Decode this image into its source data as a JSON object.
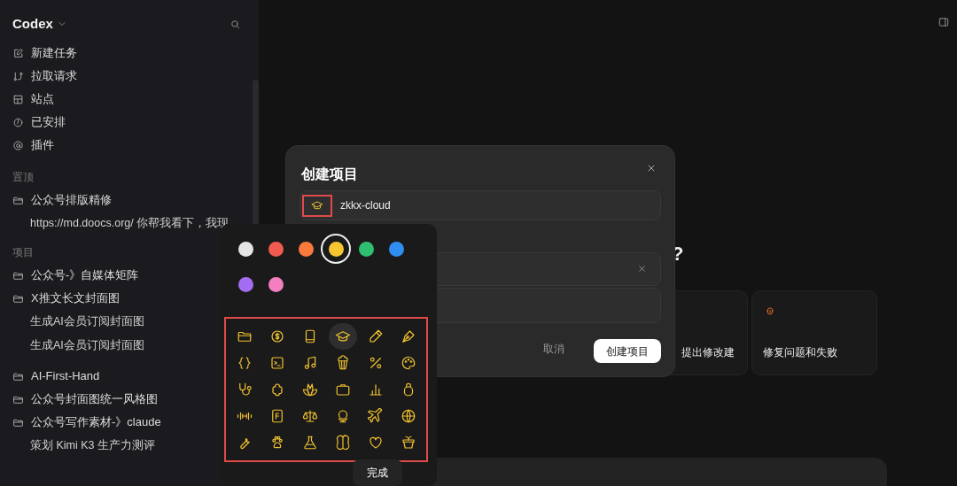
{
  "sidebar": {
    "title": "Codex",
    "nav": [
      {
        "label": "新建任务",
        "kind": "edit"
      },
      {
        "label": "拉取请求",
        "kind": "pull"
      },
      {
        "label": "站点",
        "kind": "site"
      },
      {
        "label": "已安排",
        "kind": "clock"
      },
      {
        "label": "插件",
        "kind": "at"
      }
    ],
    "pinned": {
      "heading": "置顶",
      "items": [
        {
          "label": "公众号排版精修",
          "children": [
            {
              "label": "https://md.doocs.org/ 你帮我看下，我现"
            }
          ]
        }
      ]
    },
    "projects": {
      "heading": "项目",
      "items": [
        {
          "label": "公众号-》自媒体矩阵"
        },
        {
          "label": "X推文长文封面图",
          "children": [
            {
              "label": "生成AI会员订阅封面图"
            },
            {
              "label": "生成AI会员订阅封面图"
            }
          ]
        },
        {
          "label": "AI-First-Hand"
        },
        {
          "label": "公众号封面图统一风格图"
        },
        {
          "label": "公众号写作素材-》claude",
          "children": [
            {
              "label": "策划 Kimi K3 生产力测评"
            }
          ]
        }
      ]
    }
  },
  "main": {
    "heading_tail": "?",
    "cards": [
      {
        "label": "提出修改建"
      },
      {
        "label": "修复问题和失败"
      }
    ]
  },
  "dialog": {
    "title": "创建项目",
    "name_value": "zkkx-cloud",
    "cancel": "取消",
    "submit": "创建项目"
  },
  "picker": {
    "colors": [
      {
        "color": "#e5e5e5",
        "selected": false
      },
      {
        "color": "#f05a4f",
        "selected": false
      },
      {
        "color": "#f97a3c",
        "selected": false
      },
      {
        "color": "#f7c631",
        "selected": true
      },
      {
        "color": "#2fbf71",
        "selected": false
      },
      {
        "color": "#2f8ff0",
        "selected": false
      },
      {
        "color": "#a56ef2",
        "selected": false
      },
      {
        "color": "#f47fc0",
        "selected": false
      }
    ],
    "icons": [
      {
        "selected": false
      },
      {
        "selected": false
      },
      {
        "selected": false
      },
      {
        "selected": true
      },
      {
        "selected": false
      },
      {
        "selected": false
      },
      {
        "selected": false
      },
      {
        "selected": false
      },
      {
        "selected": false
      },
      {
        "selected": false
      },
      {
        "selected": false
      },
      {
        "selected": false
      },
      {
        "selected": false
      },
      {
        "selected": false
      },
      {
        "selected": false
      },
      {
        "selected": false
      },
      {
        "selected": false
      },
      {
        "selected": false
      },
      {
        "selected": false
      },
      {
        "selected": false
      },
      {
        "selected": false
      },
      {
        "selected": false
      },
      {
        "selected": false
      },
      {
        "selected": false
      },
      {
        "selected": false
      },
      {
        "selected": false
      },
      {
        "selected": false
      },
      {
        "selected": false
      },
      {
        "selected": false
      },
      {
        "selected": false
      }
    ],
    "done": "完成"
  }
}
